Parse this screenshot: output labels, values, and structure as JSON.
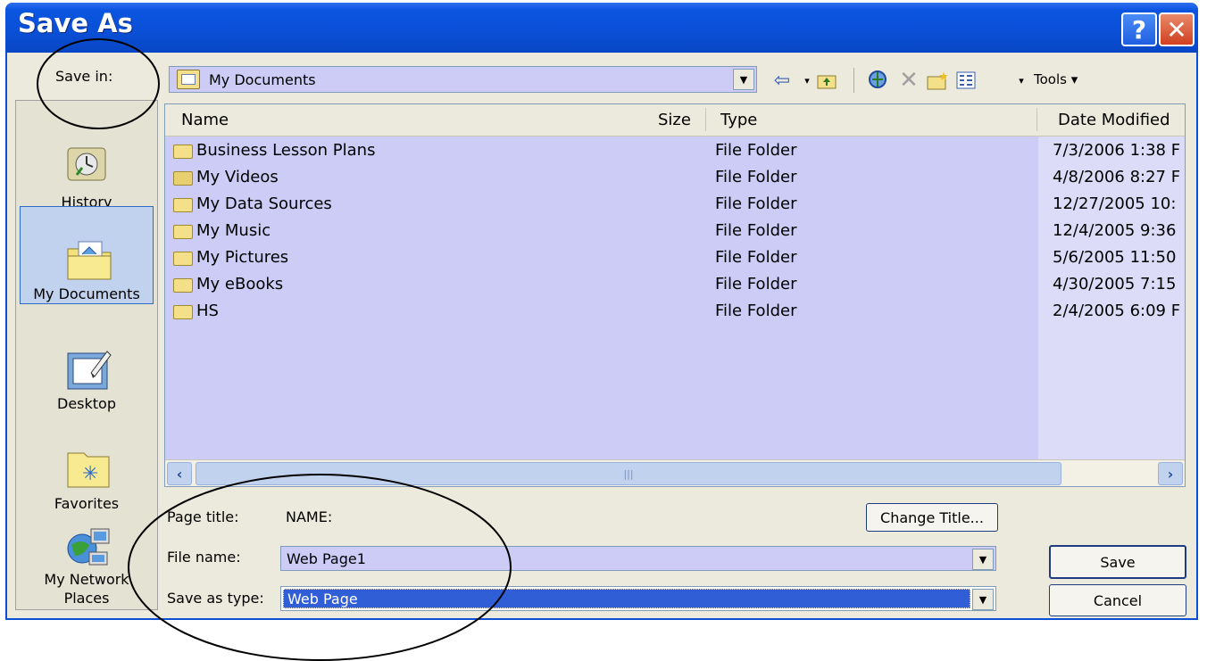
{
  "window": {
    "title": "Save As",
    "help_label": "?",
    "close_label": "✕"
  },
  "save_in": {
    "label": "Save in:",
    "value": "My Documents"
  },
  "toolbar": {
    "tools_label": "Tools ▾"
  },
  "places": [
    {
      "label": "History",
      "icon": "history-icon"
    },
    {
      "label": "My Documents",
      "icon": "my-documents-icon"
    },
    {
      "label": "Desktop",
      "icon": "desktop-icon"
    },
    {
      "label": "Favorites",
      "icon": "favorites-icon"
    },
    {
      "label": "My Network Places",
      "icon": "network-places-icon"
    }
  ],
  "file_list": {
    "columns": [
      "Name",
      "Size",
      "Type",
      "Date Modified"
    ],
    "rows": [
      {
        "name": "Business Lesson Plans",
        "type": "File Folder",
        "date": "7/3/2006 1:38 F"
      },
      {
        "name": "My Videos",
        "type": "File Folder",
        "date": "4/8/2006 8:27 F"
      },
      {
        "name": "My Data Sources",
        "type": "File Folder",
        "date": "12/27/2005 10:"
      },
      {
        "name": "My Music",
        "type": "File Folder",
        "date": "12/4/2005 9:36"
      },
      {
        "name": "My Pictures",
        "type": "File Folder",
        "date": "5/6/2005 11:50"
      },
      {
        "name": "My eBooks",
        "type": "File Folder",
        "date": "4/30/2005 7:15"
      },
      {
        "name": "HS",
        "type": "File Folder",
        "date": "2/4/2005 6:09 F"
      }
    ]
  },
  "page_title": {
    "label": "Page title:",
    "value": "NAME:",
    "change_button": "Change Title..."
  },
  "file_name": {
    "label": "File name:",
    "value": "Web Page1"
  },
  "save_as_type": {
    "label": "Save as type:",
    "value": "Web Page"
  },
  "buttons": {
    "save": "Save",
    "cancel": "Cancel"
  },
  "colors": {
    "titlebar": "#0a4fd6",
    "list_bg": "#ccccf7",
    "dialog_bg": "#eceadc",
    "selection": "#2f5ed6"
  }
}
